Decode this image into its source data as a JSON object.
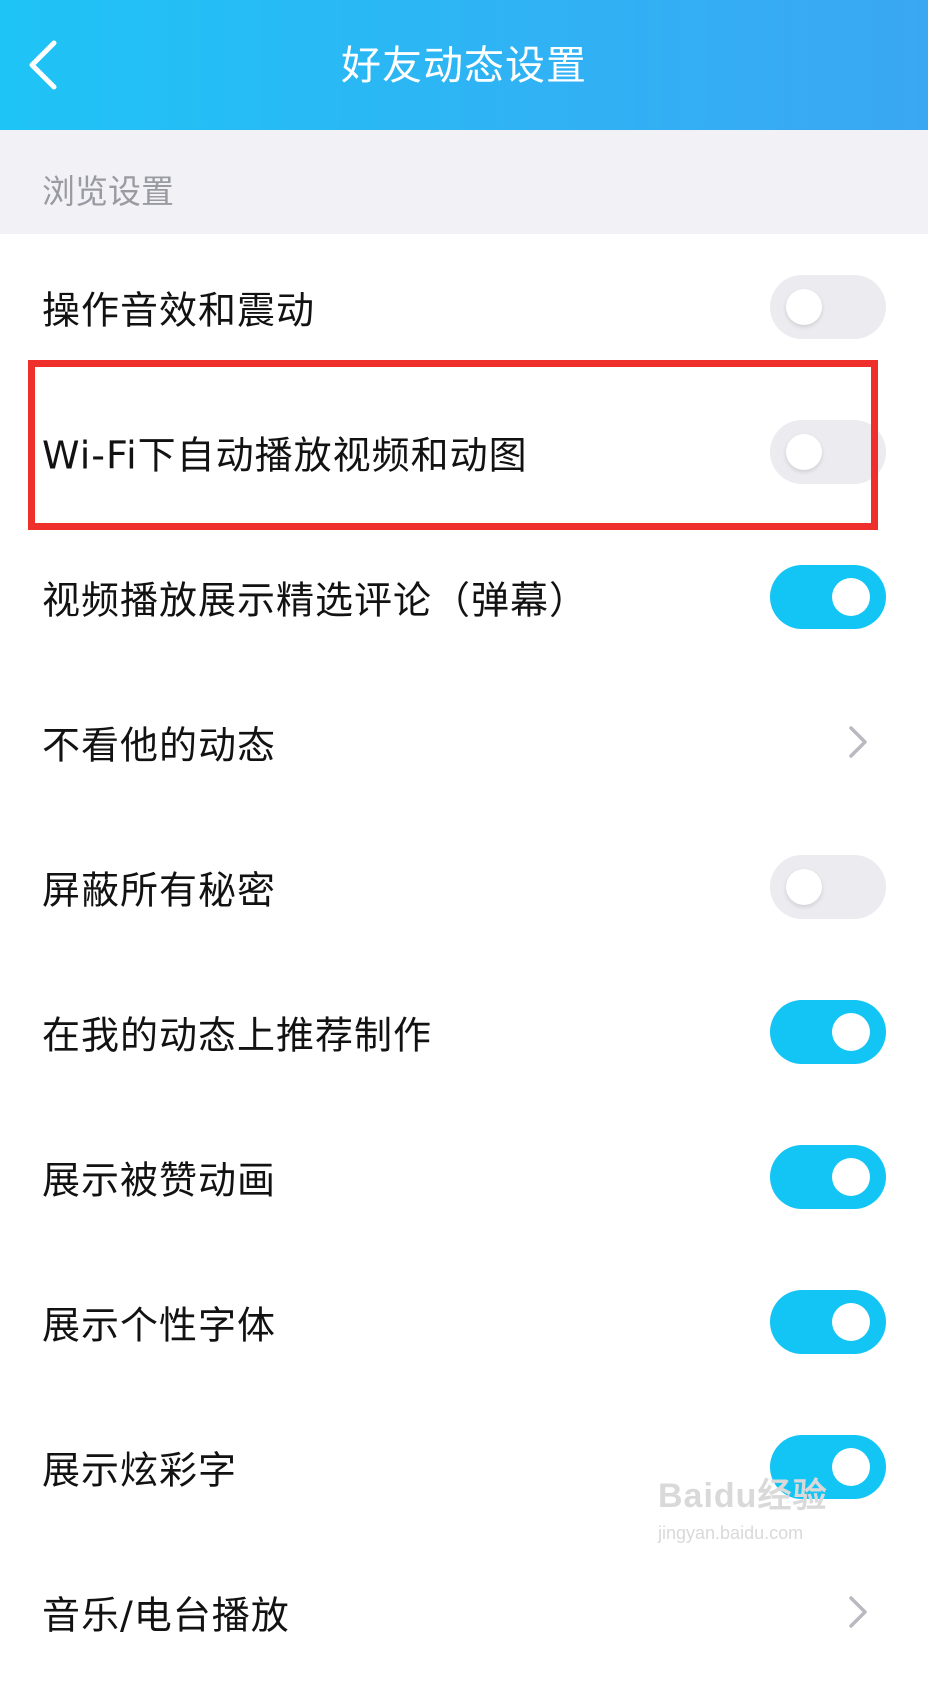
{
  "header": {
    "title": "好友动态设置",
    "back_icon": "chevron-left-icon"
  },
  "section": {
    "title": "浏览设置"
  },
  "rows": [
    {
      "label": "操作音效和震动",
      "control": "toggle",
      "on": false
    },
    {
      "label": "Wi-Fi下自动播放视频和动图",
      "control": "toggle",
      "on": false
    },
    {
      "label": "视频播放展示精选评论（弹幕）",
      "control": "toggle",
      "on": true
    },
    {
      "label": "不看他的动态",
      "control": "chevron"
    },
    {
      "label": "屏蔽所有秘密",
      "control": "toggle",
      "on": false
    },
    {
      "label": "在我的动态上推荐制作",
      "control": "toggle",
      "on": true
    },
    {
      "label": "展示被赞动画",
      "control": "toggle",
      "on": true
    },
    {
      "label": "展示个性字体",
      "control": "toggle",
      "on": true
    },
    {
      "label": "展示炫彩字",
      "control": "toggle",
      "on": true
    },
    {
      "label": "音乐/电台播放",
      "control": "chevron"
    }
  ],
  "watermark": {
    "logo": "Baidu经验",
    "url": "jingyan.baidu.com"
  },
  "colors": {
    "header_start": "#1ec4f6",
    "header_end": "#3aa7f3",
    "toggle_on": "#13c5f4",
    "toggle_off": "#ebebf0",
    "highlight": "#ee2f2c",
    "section_bg": "#f2f2f6"
  }
}
